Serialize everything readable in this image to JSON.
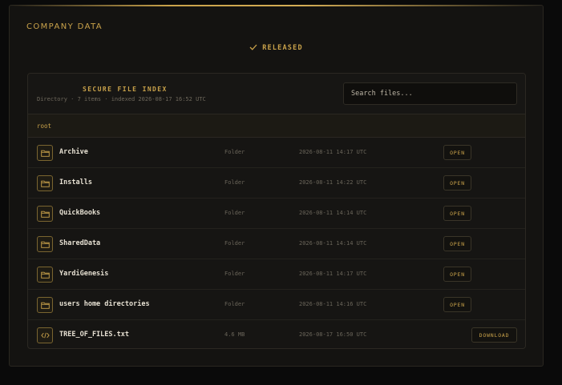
{
  "header": {
    "title": "COMPANY DATA",
    "status": "RELEASED"
  },
  "index": {
    "title": "SECURE FILE INDEX",
    "meta": "Directory · 7 items · indexed 2026-08-17 16:52 UTC",
    "search_placeholder": "Search files...",
    "breadcrumb": "root"
  },
  "files": [
    {
      "name": "Archive",
      "type": "Folder",
      "date": "2026-08-11 14:17 UTC",
      "action": "OPEN",
      "icon": "folder-icon"
    },
    {
      "name": "Installs",
      "type": "Folder",
      "date": "2026-08-11 14:22 UTC",
      "action": "OPEN",
      "icon": "folder-icon"
    },
    {
      "name": "QuickBooks",
      "type": "Folder",
      "date": "2026-08-11 14:14 UTC",
      "action": "OPEN",
      "icon": "folder-icon"
    },
    {
      "name": "SharedData",
      "type": "Folder",
      "date": "2026-08-11 14:14 UTC",
      "action": "OPEN",
      "icon": "folder-icon"
    },
    {
      "name": "YardiGenesis",
      "type": "Folder",
      "date": "2026-08-11 14:17 UTC",
      "action": "OPEN",
      "icon": "folder-icon"
    },
    {
      "name": "users home directories",
      "type": "Folder",
      "date": "2026-08-11 14:16 UTC",
      "action": "OPEN",
      "icon": "folder-icon"
    },
    {
      "name": "TREE_OF_FILES.txt",
      "type": "4.6 MB",
      "date": "2026-08-17 16:50 UTC",
      "action": "DOWNLOAD",
      "icon": "code-file-icon"
    }
  ],
  "colors": {
    "accent": "#c9a24a",
    "background": "#0a0a0a",
    "panel": "#161513"
  }
}
